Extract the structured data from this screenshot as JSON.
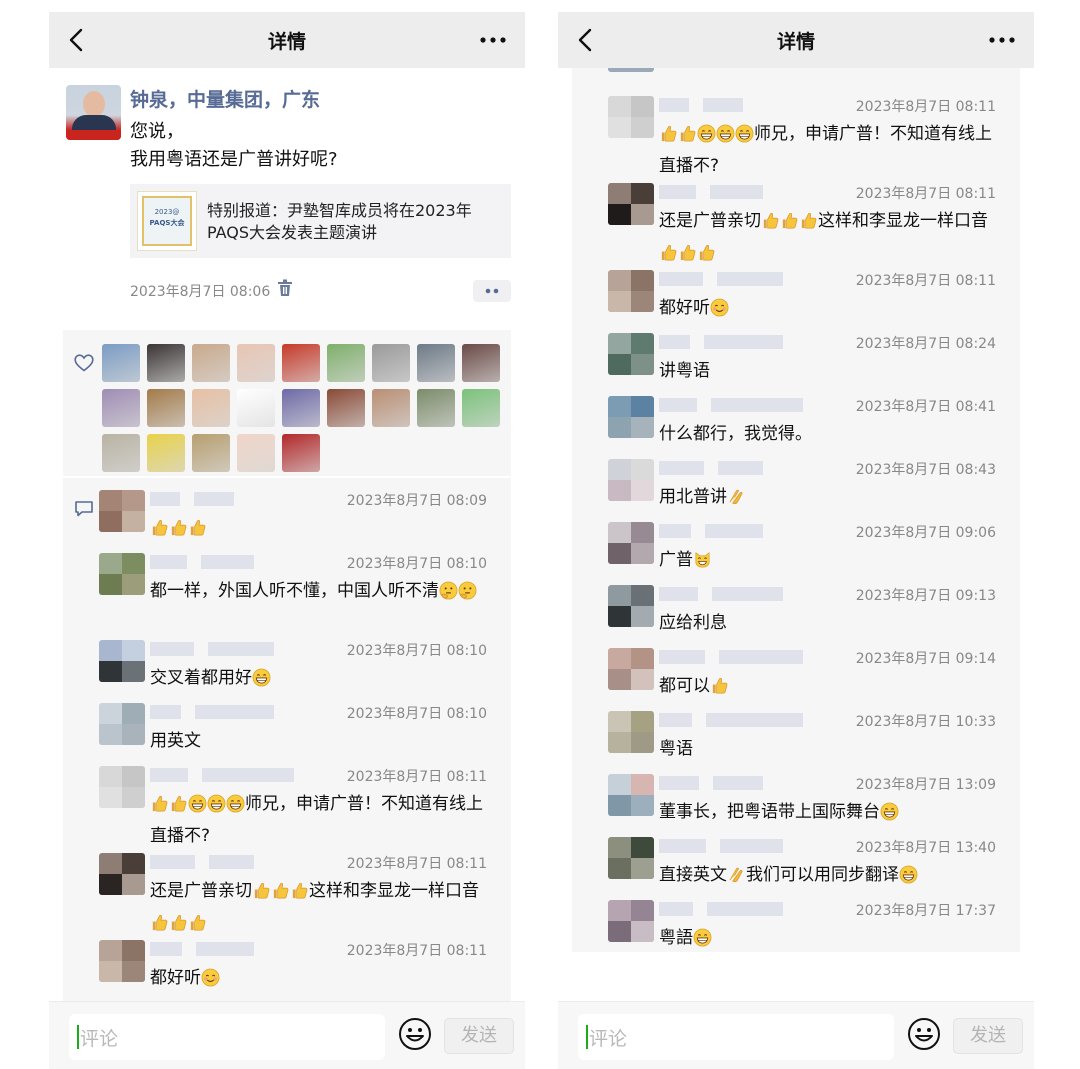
{
  "nav": {
    "title": "详情"
  },
  "post": {
    "author": "钟泉，中量集团，广东",
    "line1": "您说，",
    "line2": "我用粤语还是广普讲好呢?",
    "link": {
      "title": "特别报道：尹塾智库成员将在2023年PAQS大会发表主题演讲",
      "thumb_line1": "2023@",
      "thumb_line2": "PAQS大会"
    },
    "time": "2023年8月7日 08:06"
  },
  "likes_palette": [
    "#7a9cc4",
    "#3b3434",
    "#c9a98c",
    "#e8c6b4",
    "#c73a2a",
    "#7fb06b",
    "#9a9a9a",
    "#6d7a86",
    "#6a4a46",
    "#9f8db4",
    "#a37b4a",
    "#e6c0a3",
    "#ffffff",
    "#6e6aa8",
    "#8a4a36",
    "#b98f74",
    "#7c8c6a",
    "#7bc27a",
    "#b9b3a3",
    "#e8d24a",
    "#b79f6f",
    "#f0d6c8",
    "#b3282a"
  ],
  "comments_left": [
    {
      "time": "2023年8月7日 08:09",
      "text": "",
      "emoji_after": [
        "thumb",
        "thumb",
        "thumb"
      ],
      "av": [
        "#a48474",
        "#b4998a",
        "#8f6e5f",
        "#c5b1a2"
      ]
    },
    {
      "time": "2023年8月7日 08:10",
      "text": "都一样，外国人听不懂，中国人听不清",
      "emoji_after": [
        "think",
        "think"
      ],
      "av": [
        "#9aa98b",
        "#7c8e5f",
        "#6e7d51",
        "#9c9d7b"
      ]
    },
    {
      "time": "2023年8月7日 08:10",
      "text": "交叉着都用好",
      "emoji_after": [
        "grin"
      ],
      "av": [
        "#a8b7cf",
        "#c4cfdf",
        "#2f3437",
        "#6a7278"
      ]
    },
    {
      "time": "2023年8月7日 08:10",
      "text": "用英文",
      "emoji_after": [],
      "av": [
        "#cbd4da",
        "#9eadb6",
        "#b9c4cc",
        "#a8b3bb"
      ]
    },
    {
      "time": "2023年8月7日 08:11",
      "pre": [
        "thumb",
        "thumb",
        "grin",
        "grin",
        "grin"
      ],
      "text": "师兄，申请广普！不知道有线上直播不?",
      "emoji_after": [],
      "av": [
        "#d8d8d8",
        "#c6c6c6",
        "#e0e0e0",
        "#cfcfcf"
      ]
    },
    {
      "time": "2023年8月7日 08:11",
      "text": "还是广普亲切",
      "mid": [
        "thumb",
        "thumb",
        "thumb"
      ],
      "text2": "这样和李显龙一样口音",
      "emoji_after": [
        "thumb",
        "thumb",
        "thumb"
      ],
      "av": [
        "#8d7d74",
        "#4a3e38",
        "#2a2422",
        "#a89a90"
      ]
    },
    {
      "time": "2023年8月7日 08:11",
      "text": "都好听",
      "emoji_after": [
        "smile"
      ],
      "av": [
        "#b7a397",
        "#8b7466",
        "#c9b8aa",
        "#9c8679"
      ]
    }
  ],
  "comments_right": [
    {
      "time": "2023年8月7日 08:11",
      "pre": [
        "thumb",
        "thumb",
        "grin",
        "grin",
        "grin"
      ],
      "text": "师兄，申请广普！不知道有线上直播不?",
      "emoji_after": [],
      "av": [
        "#d8d8d8",
        "#c6c6c6",
        "#e0e0e0",
        "#cfcfcf"
      ]
    },
    {
      "time": "2023年8月7日 08:11",
      "text": "还是广普亲切",
      "mid": [
        "thumb",
        "thumb",
        "thumb"
      ],
      "text2": "这样和李显龙一样口音",
      "emoji_after": [
        "thumb",
        "thumb",
        "thumb"
      ],
      "av": [
        "#8d7d74",
        "#4a3e38",
        "#1f1b1a",
        "#a89a90"
      ]
    },
    {
      "time": "2023年8月7日 08:11",
      "text": "都好听",
      "emoji_after": [
        "smile"
      ],
      "av": [
        "#b7a397",
        "#8b7466",
        "#c9b8aa",
        "#9c8679"
      ]
    },
    {
      "time": "2023年8月7日 08:24",
      "text": "讲粤语",
      "emoji_after": [],
      "av": [
        "#94a6a0",
        "#5f7a6f",
        "#4f6b5f",
        "#7d9189"
      ]
    },
    {
      "time": "2023年8月7日 08:41",
      "text": "什么都行，我觉得。",
      "emoji_after": [],
      "av": [
        "#7c9cb4",
        "#5b82a3",
        "#8da4b0",
        "#a6b3bb"
      ]
    },
    {
      "time": "2023年8月7日 08:43",
      "text": "用北普讲",
      "emoji_after": [
        "clap"
      ],
      "av": [
        "#cfd3d9",
        "#dadada",
        "#c8b9c3",
        "#e2d7db"
      ]
    },
    {
      "time": "2023年8月7日 09:06",
      "text": "广普",
      "emoji_after": [
        "cat"
      ],
      "av": [
        "#cbc4c8",
        "#978a92",
        "#6f6269",
        "#b3a8ad"
      ]
    },
    {
      "time": "2023年8月7日 09:13",
      "text": "应给利息",
      "emoji_after": [],
      "av": [
        "#8f9aa0",
        "#697177",
        "#2f3436",
        "#a3aab0"
      ]
    },
    {
      "time": "2023年8月7日 09:14",
      "text": "都可以",
      "emoji_after": [
        "thumb"
      ],
      "av": [
        "#c7a9a0",
        "#b39385",
        "#a88f87",
        "#d2c2bb"
      ]
    },
    {
      "time": "2023年8月7日 10:33",
      "text": "粤语",
      "emoji_after": [],
      "av": [
        "#c9c4b3",
        "#a7a184",
        "#b7b29e",
        "#9e9a85"
      ]
    },
    {
      "time": "2023年8月7日 13:09",
      "text": "董事长，把粤语带上国际舞台",
      "emoji_after": [
        "grin"
      ],
      "av": [
        "#c6d0d9",
        "#d7b5b0",
        "#7f97a7",
        "#9bb0bc"
      ]
    },
    {
      "time": "2023年8月7日 13:40",
      "text": "直接英文",
      "mid": [
        "clap"
      ],
      "text2": "我们可以用同步翻译",
      "emoji_after": [
        "grin"
      ],
      "av": [
        "#8d8f7e",
        "#3e4a3b",
        "#6a6f5f",
        "#9d9f91"
      ]
    },
    {
      "time": "2023年8月7日 17:37",
      "text": "粤語",
      "emoji_after": [
        "grin"
      ],
      "av": [
        "#b6a5b1",
        "#958493",
        "#7a6c78",
        "#c8bcc5"
      ]
    }
  ],
  "bottom": {
    "placeholder": "评论",
    "send": "发送"
  },
  "colors": {
    "author_link": "#576b95",
    "time": "#888888",
    "nav_bg": "#ededed",
    "comment_bg": "#f6f6f6"
  }
}
